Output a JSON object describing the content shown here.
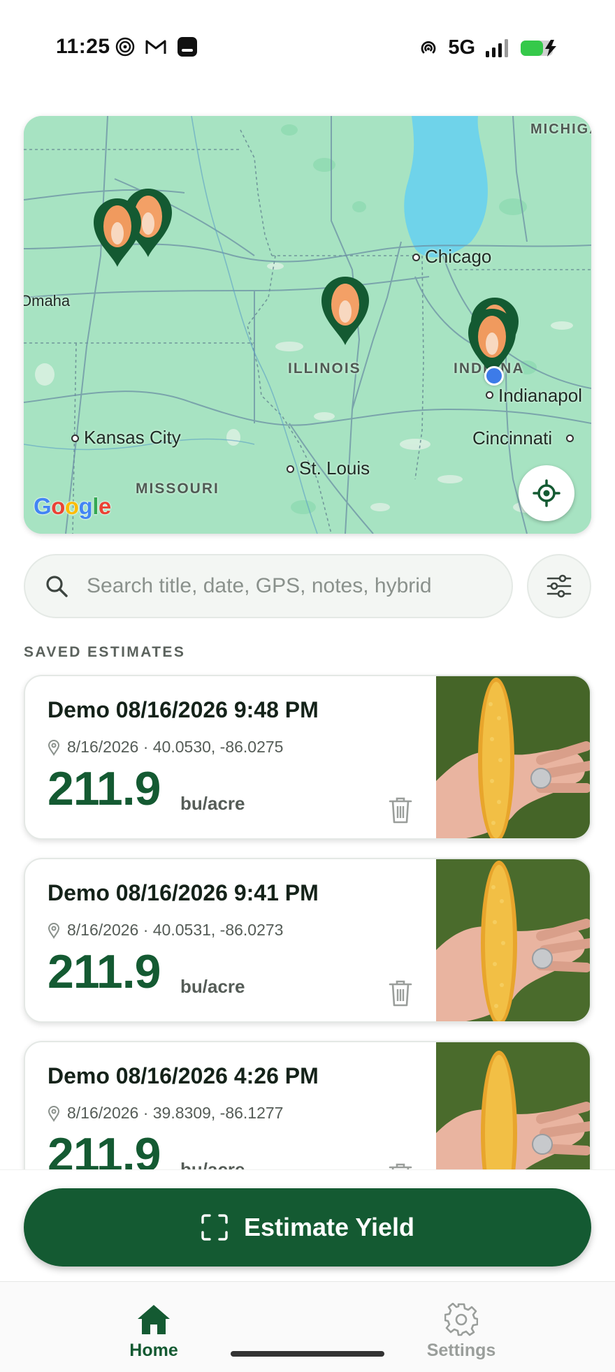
{
  "status_bar": {
    "time": "11:25",
    "network": "5G",
    "left_icons": [
      "radar-icon",
      "gmail-icon",
      "app-icon"
    ],
    "right_icons": [
      "hotspot-icon",
      "signal-icon",
      "battery-charging-icon"
    ],
    "battery_color": "#35c94a"
  },
  "map": {
    "labels": {
      "michigan": "MICHIGA",
      "chicago": "Chicago",
      "omaha": "Omaha",
      "illinois": "ILLINOIS",
      "indiana": "INDIANA",
      "indianapolis": "Indianapol",
      "kansas_city": "Kansas City",
      "st_louis": "St. Louis",
      "cincinnati": "Cincinnati",
      "missouri": "MISSOURI"
    },
    "attribution": "Google",
    "pin_color": "#145a32",
    "water_color": "#6fd3ea",
    "land_color": "#a7e3c2"
  },
  "search": {
    "placeholder": "Search title, date, GPS, notes, hybrid",
    "value": ""
  },
  "section_title": "SAVED ESTIMATES",
  "estimates": [
    {
      "title": "Demo 08/16/2026 9:48 PM",
      "meta": "8/16/2026 · 40.0530, -86.0275",
      "value": "211.9",
      "unit": "bu/acre"
    },
    {
      "title": "Demo 08/16/2026 9:41 PM",
      "meta": "8/16/2026 · 40.0531, -86.0273",
      "value": "211.9",
      "unit": "bu/acre"
    },
    {
      "title": "Demo 08/16/2026 4:26 PM",
      "meta": "8/16/2026 · 39.8309, -86.1277",
      "value": "211.9",
      "unit": "bu/acre"
    }
  ],
  "estimate_button": {
    "label": "Estimate Yield",
    "color": "#145a32"
  },
  "nav": {
    "home": "Home",
    "settings": "Settings"
  }
}
